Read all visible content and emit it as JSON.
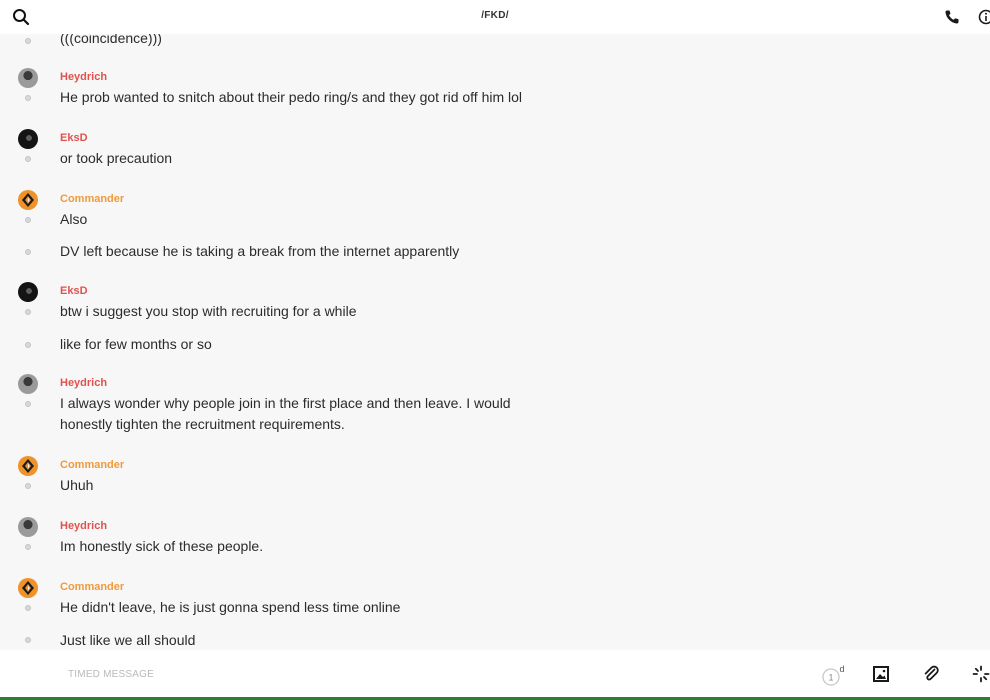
{
  "header": {
    "title": "/FKD/"
  },
  "composer": {
    "placeholder": "TIMED MESSAGE",
    "timer_value": "1",
    "timer_unit": "d"
  },
  "colors": {
    "red_name": "#e0524d",
    "orange_name": "#f09a3a",
    "commander_avatar": "#f0922a"
  },
  "messages": [
    {
      "text": "(((coincidence)))"
    },
    {
      "sender": "Heydrich",
      "text": "He prob wanted to snitch about their pedo ring/s and they got rid off him lol"
    },
    {
      "sender": "EksD",
      "text": "or took precaution"
    },
    {
      "sender": "Commander",
      "text": "Also"
    },
    {
      "text": "DV left because he is taking a break from the internet apparently"
    },
    {
      "sender": "EksD",
      "text": "btw i suggest you stop with recruiting for a while"
    },
    {
      "text": "like for few months or so"
    },
    {
      "sender": "Heydrich",
      "text": "I always wonder why people join in the first place and then leave. I would honestly tighten the recruitment requirements."
    },
    {
      "sender": "Commander",
      "text": "Uhuh"
    },
    {
      "sender": "Heydrich",
      "text": "Im honestly sick of these people."
    },
    {
      "sender": "Commander",
      "text": "He didn't leave, he is just gonna spend less time online"
    },
    {
      "text": "Just like we all should"
    }
  ]
}
